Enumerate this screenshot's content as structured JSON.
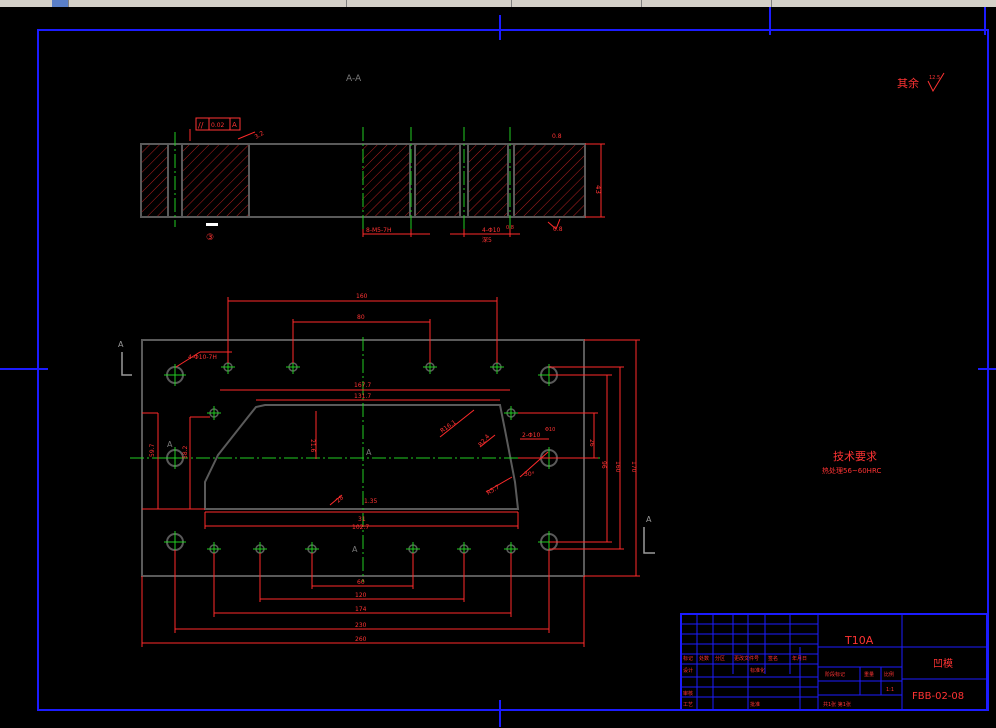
{
  "toolbar": {
    "background": "#d4d0c8"
  },
  "colors": {
    "background": "#000000",
    "frame": "#1c1cff",
    "dimension": "#ff2a2a",
    "outline": "#5a5a5a",
    "centerline": "#22cc22",
    "hatch": "#b02020",
    "text_red": "#ff3333"
  },
  "drawing": {
    "section_label": "A-A",
    "surface_rest": "其余",
    "roughness_12_5": "12.5",
    "flatness_symbol": "//",
    "flatness_value": "0.02",
    "flatness_datum": "A",
    "datum_mark": "A",
    "section_view": {
      "dim_43": "43",
      "roughness_3_2": "3.2",
      "roughness_0_8": "0.8",
      "thread_8_m5": "8-M5-7H",
      "hole_4_phi10": "4-Φ10",
      "depth_note": "深5",
      "label_circle": "③"
    },
    "plan_view": {
      "dim_160": "160",
      "dim_80": "80",
      "dim_167_7": "167.7",
      "dim_131_7": "131.7",
      "dim_21_6": "21.6",
      "dim_59_7": "59.7",
      "dim_58_2": "58.2",
      "dim_r16_1": "R16.1",
      "dim_r2_4": "R2.4",
      "dim_r5_7": "R5.7",
      "dim_2_phi10": "2-Φ10",
      "dim_phi10": "Φ10",
      "dim_30deg": "30°",
      "dim_28": "28",
      "dim_31": "31",
      "dim_102_7": "102.7",
      "dim_26": "26",
      "dim_96": "96",
      "dim_160v": "160",
      "dim_170": "170",
      "dim_60": "60",
      "dim_120": "120",
      "dim_174": "174",
      "dim_230": "230",
      "dim_260": "260",
      "holes_note": "4-Φ10-7H",
      "dim_1_35": "1.35",
      "section_a1": "A",
      "section_a2": "A",
      "center_a": "A",
      "bottom_a": "A"
    },
    "tech_req_title": "技术要求",
    "tech_req_text": "热处理56~60HRC"
  },
  "title_block": {
    "material": "T10A",
    "part_name": "凹模",
    "drawing_no": "FBB-02-08",
    "row_biaoji": "标记",
    "row_chushu": "处数",
    "row_fenqu": "分区",
    "row_gengai": "更改文件号",
    "row_qianming": "签名",
    "row_nianyue": "年月日",
    "design": "设计",
    "standard": "标准化",
    "stage_label": "阶段标记",
    "weight": "重量",
    "scale": "比例",
    "scale_value": "1:1",
    "review": "审核",
    "process": "工艺",
    "approve": "批准",
    "sheets": "共1张 第1张"
  }
}
